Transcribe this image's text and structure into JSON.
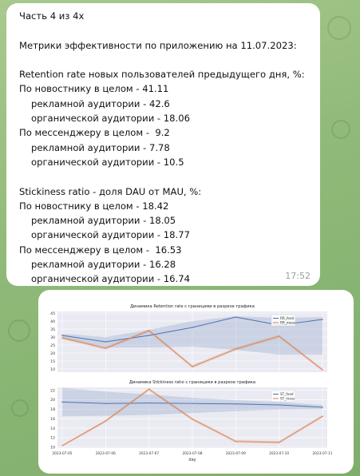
{
  "message": {
    "lines": [
      {
        "text": "Часть 4 из 4х",
        "indent": false
      },
      {
        "text": "",
        "indent": false
      },
      {
        "text": "Метрики эффективности по приложению на 11.07.2023:",
        "indent": false
      },
      {
        "text": "",
        "indent": false
      },
      {
        "text": "Retention rate новых пользователей предыдущего дня, %:",
        "indent": false
      },
      {
        "text": "По новостнику в целом - 41.11",
        "indent": false
      },
      {
        "text": "рекламной аудитории - 42.6",
        "indent": true
      },
      {
        "text": "органической аудитории - 18.06",
        "indent": true
      },
      {
        "text": "По мессенджеру в целом -  9.2",
        "indent": false
      },
      {
        "text": "рекламной аудитории - 7.78",
        "indent": true
      },
      {
        "text": "органической аудитории - 10.5",
        "indent": true
      },
      {
        "text": "",
        "indent": false
      },
      {
        "text": "Stickiness ratio - доля DAU от MAU, %:",
        "indent": false
      },
      {
        "text": "По новостнику в целом - 18.42",
        "indent": false
      },
      {
        "text": "рекламной аудитории - 18.05",
        "indent": true
      },
      {
        "text": "органической аудитории - 18.77",
        "indent": true
      },
      {
        "text": "По мессенджеру в целом -  16.53",
        "indent": false
      },
      {
        "text": "рекламной аудитории - 16.28",
        "indent": true
      },
      {
        "text": "органической аудитории - 16.74",
        "indent": true
      }
    ],
    "time": "17:52"
  },
  "colors": {
    "feed": "#4c72b0",
    "mess": "#dd8452",
    "plot_bg": "#eaeaf2"
  },
  "chart_data": [
    {
      "type": "line",
      "title": "Динамика Retention rate с границами в разрезе трафика",
      "xlabel": "",
      "ylabel": "",
      "x": [
        "2023-07-05",
        "2023-07-06",
        "2023-07-07",
        "2023-07-08",
        "2023-07-09",
        "2023-07-10",
        "2023-07-11"
      ],
      "ylim": [
        8,
        46
      ],
      "yticks": [
        10,
        15,
        20,
        25,
        30,
        35,
        40,
        45
      ],
      "series": [
        {
          "name": "RR_feed",
          "values": [
            31,
            27,
            31,
            36,
            42.5,
            37.5,
            41
          ],
          "lower": [
            29,
            23.5,
            23.5,
            24,
            22,
            19,
            19
          ],
          "upper": [
            32,
            30,
            34.5,
            40,
            43,
            42,
            42.5
          ]
        },
        {
          "name": "RR_mess",
          "values": [
            29.5,
            23,
            34,
            11.5,
            22.5,
            30.5,
            9.5
          ],
          "lower": [
            28.5,
            22,
            33,
            10.5,
            21.5,
            29.5,
            8.5
          ],
          "upper": [
            30.5,
            24,
            35,
            12.5,
            23.5,
            31.5,
            10.5
          ]
        }
      ],
      "legend": "top-right",
      "grid": true
    },
    {
      "type": "line",
      "title": "Динамика Stickiness ratio с границами в разрезе трафика",
      "xlabel": "day",
      "ylabel": "",
      "x": [
        "2023-07-05",
        "2023-07-06",
        "2023-07-07",
        "2023-07-08",
        "2023-07-09",
        "2023-07-10",
        "2023-07-11"
      ],
      "ylim": [
        9.8,
        22.6
      ],
      "yticks": [
        10,
        12,
        14,
        16,
        18,
        20,
        22
      ],
      "series": [
        {
          "name": "ST_feed",
          "values": [
            19.5,
            19.2,
            19.3,
            19.2,
            19.1,
            18.9,
            18.4
          ],
          "lower": [
            16.5,
            16.6,
            16.8,
            17.2,
            17.6,
            17.9,
            18.0
          ],
          "upper": [
            22.5,
            21.7,
            21.1,
            20.4,
            19.9,
            19.5,
            18.9
          ]
        },
        {
          "name": "ST_mess",
          "values": [
            10.3,
            15.5,
            22.2,
            15.9,
            11.2,
            11.0,
            16.5
          ],
          "lower": [
            10.1,
            15.2,
            21.9,
            15.6,
            10.9,
            10.7,
            16.2
          ],
          "upper": [
            10.5,
            15.8,
            22.5,
            16.2,
            11.5,
            11.3,
            16.8
          ]
        }
      ],
      "legend": "top-right",
      "grid": true
    }
  ]
}
